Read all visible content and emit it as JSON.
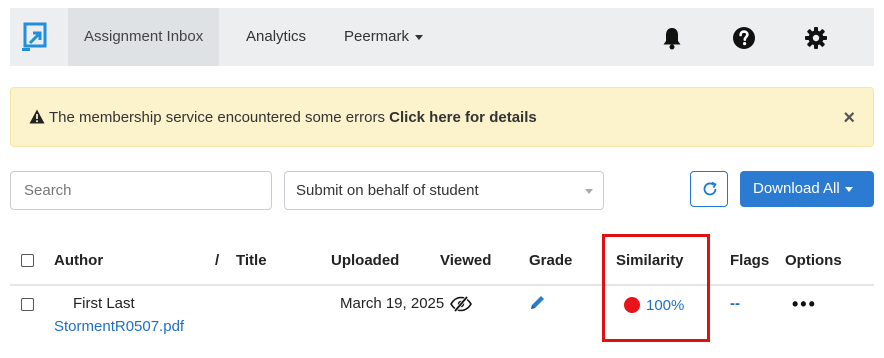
{
  "nav": {
    "tabs": [
      "Assignment Inbox",
      "Analytics",
      "Peermark"
    ],
    "icons": [
      "bell-icon",
      "help-icon",
      "gear-icon"
    ],
    "accent": "#2a7bd1"
  },
  "alert": {
    "message": "The membership service encountered some errors",
    "link_text": "Click here for details",
    "close_label": "×",
    "background": "#fcf3cd"
  },
  "toolbar": {
    "search_placeholder": "Search",
    "submit_select_value": "Submit on behalf of student",
    "download_label": "Download All"
  },
  "table": {
    "columns": {
      "author": "Author",
      "slash": "/",
      "title": "Title",
      "uploaded": "Uploaded",
      "viewed": "Viewed",
      "grade": "Grade",
      "similarity": "Similarity",
      "flags": "Flags",
      "options": "Options"
    },
    "rows": [
      {
        "author": "First Last",
        "file": "StormentR0507.pdf",
        "uploaded": "March 19, 2025",
        "similarity": "100%",
        "similarity_color": "#e8141b",
        "flags": "--",
        "options": "•••"
      }
    ]
  }
}
